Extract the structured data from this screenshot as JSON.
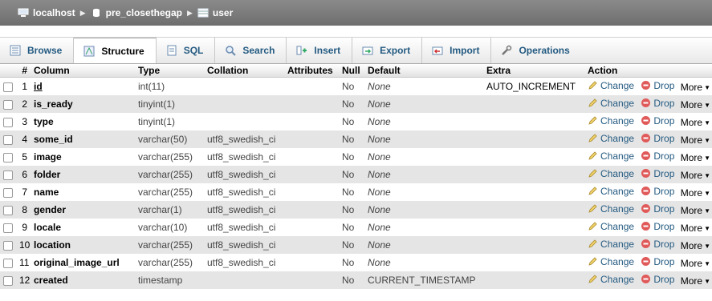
{
  "breadcrumb": {
    "server": "localhost",
    "database": "pre_closethegap",
    "table": "user"
  },
  "tabs": [
    {
      "label": "Browse",
      "icon": "browse-icon",
      "active": false
    },
    {
      "label": "Structure",
      "icon": "structure-icon",
      "active": true
    },
    {
      "label": "SQL",
      "icon": "sql-icon",
      "active": false
    },
    {
      "label": "Search",
      "icon": "search-icon",
      "active": false
    },
    {
      "label": "Insert",
      "icon": "insert-icon",
      "active": false
    },
    {
      "label": "Export",
      "icon": "export-icon",
      "active": false
    },
    {
      "label": "Import",
      "icon": "import-icon",
      "active": false
    },
    {
      "label": "Operations",
      "icon": "wrench-icon",
      "active": false
    }
  ],
  "headers": {
    "num": "#",
    "column": "Column",
    "type": "Type",
    "collation": "Collation",
    "attributes": "Attributes",
    "null": "Null",
    "default": "Default",
    "extra": "Extra",
    "action": "Action"
  },
  "actions": {
    "change": "Change",
    "drop": "Drop",
    "more": "More"
  },
  "rows": [
    {
      "num": "1",
      "name": "id",
      "type": "int(11)",
      "collation": "",
      "attributes": "",
      "null": "No",
      "default": "None",
      "extra": "AUTO_INCREMENT",
      "primary": true
    },
    {
      "num": "2",
      "name": "is_ready",
      "type": "tinyint(1)",
      "collation": "",
      "attributes": "",
      "null": "No",
      "default": "None",
      "extra": ""
    },
    {
      "num": "3",
      "name": "type",
      "type": "tinyint(1)",
      "collation": "",
      "attributes": "",
      "null": "No",
      "default": "None",
      "extra": ""
    },
    {
      "num": "4",
      "name": "some_id",
      "type": "varchar(50)",
      "collation": "utf8_swedish_ci",
      "attributes": "",
      "null": "No",
      "default": "None",
      "extra": ""
    },
    {
      "num": "5",
      "name": "image",
      "type": "varchar(255)",
      "collation": "utf8_swedish_ci",
      "attributes": "",
      "null": "No",
      "default": "None",
      "extra": ""
    },
    {
      "num": "6",
      "name": "folder",
      "type": "varchar(255)",
      "collation": "utf8_swedish_ci",
      "attributes": "",
      "null": "No",
      "default": "None",
      "extra": ""
    },
    {
      "num": "7",
      "name": "name",
      "type": "varchar(255)",
      "collation": "utf8_swedish_ci",
      "attributes": "",
      "null": "No",
      "default": "None",
      "extra": ""
    },
    {
      "num": "8",
      "name": "gender",
      "type": "varchar(1)",
      "collation": "utf8_swedish_ci",
      "attributes": "",
      "null": "No",
      "default": "None",
      "extra": ""
    },
    {
      "num": "9",
      "name": "locale",
      "type": "varchar(10)",
      "collation": "utf8_swedish_ci",
      "attributes": "",
      "null": "No",
      "default": "None",
      "extra": ""
    },
    {
      "num": "10",
      "name": "location",
      "type": "varchar(255)",
      "collation": "utf8_swedish_ci",
      "attributes": "",
      "null": "No",
      "default": "None",
      "extra": ""
    },
    {
      "num": "11",
      "name": "original_image_url",
      "type": "varchar(255)",
      "collation": "utf8_swedish_ci",
      "attributes": "",
      "null": "No",
      "default": "None",
      "extra": ""
    },
    {
      "num": "12",
      "name": "created",
      "type": "timestamp",
      "collation": "",
      "attributes": "",
      "null": "No",
      "default": "CURRENT_TIMESTAMP",
      "extra": ""
    }
  ]
}
